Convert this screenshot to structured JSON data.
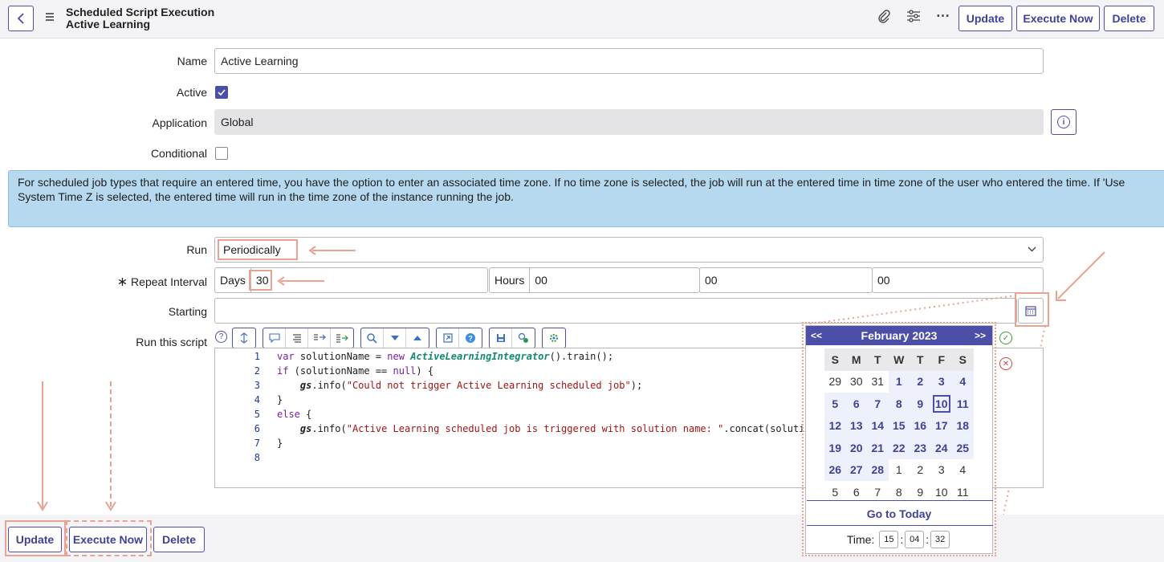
{
  "header": {
    "title_line1": "Scheduled Script Execution",
    "title_line2": "Active Learning",
    "buttons": {
      "update": "Update",
      "execute_now": "Execute Now",
      "delete": "Delete"
    }
  },
  "form": {
    "name_label": "Name",
    "name_value": "Active Learning",
    "active_label": "Active",
    "active_checked": true,
    "application_label": "Application",
    "application_value": "Global",
    "conditional_label": "Conditional",
    "conditional_checked": false,
    "info_text": "For scheduled job types that require an entered time, you have the option to enter an associated time zone. If no time zone is selected, the job will run at the entered time in time zone of the user who entered the time. If 'Use System Time Z is selected, the entered time will run in the time zone of the instance running the job.",
    "run_label": "Run",
    "run_value": "Periodically",
    "repeat_required_mark": "∗",
    "repeat_label": "Repeat Interval",
    "days_label": "Days",
    "days_value": "30",
    "hours_label": "Hours",
    "hours_value": "00",
    "minutes_value": "00",
    "seconds_value": "00",
    "starting_label": "Starting",
    "starting_value": "",
    "script_label": "Run this script"
  },
  "script": {
    "line_numbers": [
      "1",
      "2",
      "3",
      "4",
      "5",
      "6",
      "7",
      "8"
    ]
  },
  "footer": {
    "update": "Update",
    "execute_now": "Execute Now",
    "delete": "Delete"
  },
  "calendar": {
    "prev": "<<",
    "next": ">>",
    "month_year": "February 2023",
    "weekdays": [
      "S",
      "M",
      "T",
      "W",
      "T",
      "F",
      "S"
    ],
    "weeks": [
      [
        "29",
        "30",
        "31",
        "1",
        "2",
        "3",
        "4"
      ],
      [
        "5",
        "6",
        "7",
        "8",
        "9",
        "10",
        "11"
      ],
      [
        "12",
        "13",
        "14",
        "15",
        "16",
        "17",
        "18"
      ],
      [
        "19",
        "20",
        "21",
        "22",
        "23",
        "24",
        "25"
      ],
      [
        "26",
        "27",
        "28",
        "1",
        "2",
        "3",
        "4"
      ],
      [
        "5",
        "6",
        "7",
        "8",
        "9",
        "10",
        "11"
      ]
    ],
    "selected_day": "10",
    "go_to_today": "Go to Today",
    "time_label": "Time:",
    "time_hh": "15",
    "time_mm": "04",
    "time_ss": "32"
  },
  "colors": {
    "accent": "#4c4fa8",
    "annotation": "#e8a395",
    "info_bg": "#b6d9f0"
  }
}
